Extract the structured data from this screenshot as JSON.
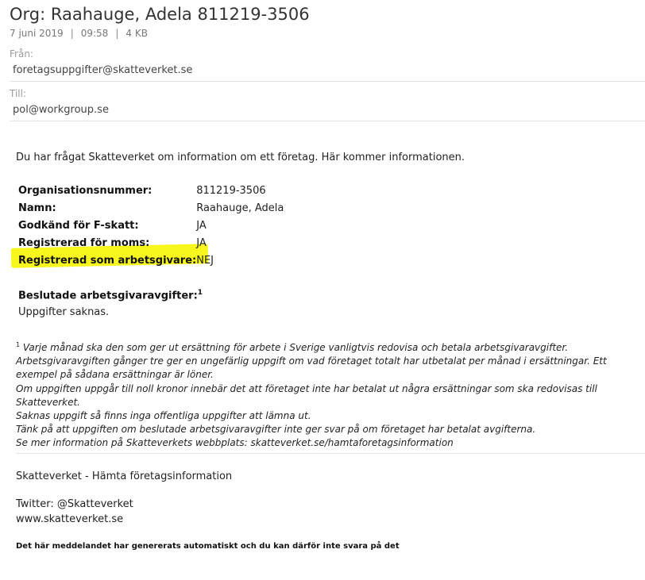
{
  "email": {
    "subject": "Org: Raahauge, Adela 811219-3506",
    "date": "7 juni 2019",
    "time": "09:58",
    "size": "4 KB",
    "separator": "|",
    "from_label": "Från:",
    "from_value": "foretagsuppgifter@skatteverket.se",
    "to_label": "Till:",
    "to_value": "pol@workgroup.se"
  },
  "body": {
    "intro": "Du har frågat Skatteverket om information om ett företag. Här kommer informationen.",
    "fields": [
      {
        "label": "Organisationsnummer:",
        "value": "811219-3506"
      },
      {
        "label": "Namn:",
        "value": "Raahauge, Adela"
      },
      {
        "label": "Godkänd för F-skatt:",
        "value": "JA"
      },
      {
        "label": "Registrerad för moms:",
        "value": "JA"
      },
      {
        "label": "Registrerad som arbetsgivare:",
        "value": "NEJ"
      }
    ],
    "section_title": "Beslutade arbetsgivaravgifter:",
    "section_sup": "1",
    "section_value": "Uppgifter saknas.",
    "footnote_sup": "1",
    "footnote_lines": [
      " Varje månad ska den som ger ut ersättning för arbete i Sverige vanligtvis redovisa och betala arbetsgivaravgifter.",
      "Arbetsgivaravgiften gånger tre ger en ungefärlig uppgift om vad företaget totalt har utbetalat per månad i ersättningar. Ett exempel på sådana ersättningar är löner.",
      "Om uppgiften uppgår till noll kronor innebär det att företaget inte har betalat ut några ersättningar som ska redovisas till Skatteverket.",
      "Saknas uppgift så finns inga offentliga uppgifter att lämna ut.",
      "Tänk på att uppgiften om beslutade arbetsgivaravgifter inte ger svar på om företaget har betalat avgifterna.",
      "Se mer information på Skatteverkets webbplats: skatteverket.se/hamtaforetagsinformation"
    ]
  },
  "footer": {
    "title": "Skatteverket - Hämta företagsinformation",
    "twitter": "Twitter: @Skatteverket",
    "website": "www.skatteverket.se",
    "auto_note": "Det här meddelandet har genererats automatiskt och du kan därför inte svara på det"
  },
  "colors": {
    "highlight": "#f7f71e",
    "divider": "#e3e3e3",
    "label_gray": "#9a9a9a"
  }
}
